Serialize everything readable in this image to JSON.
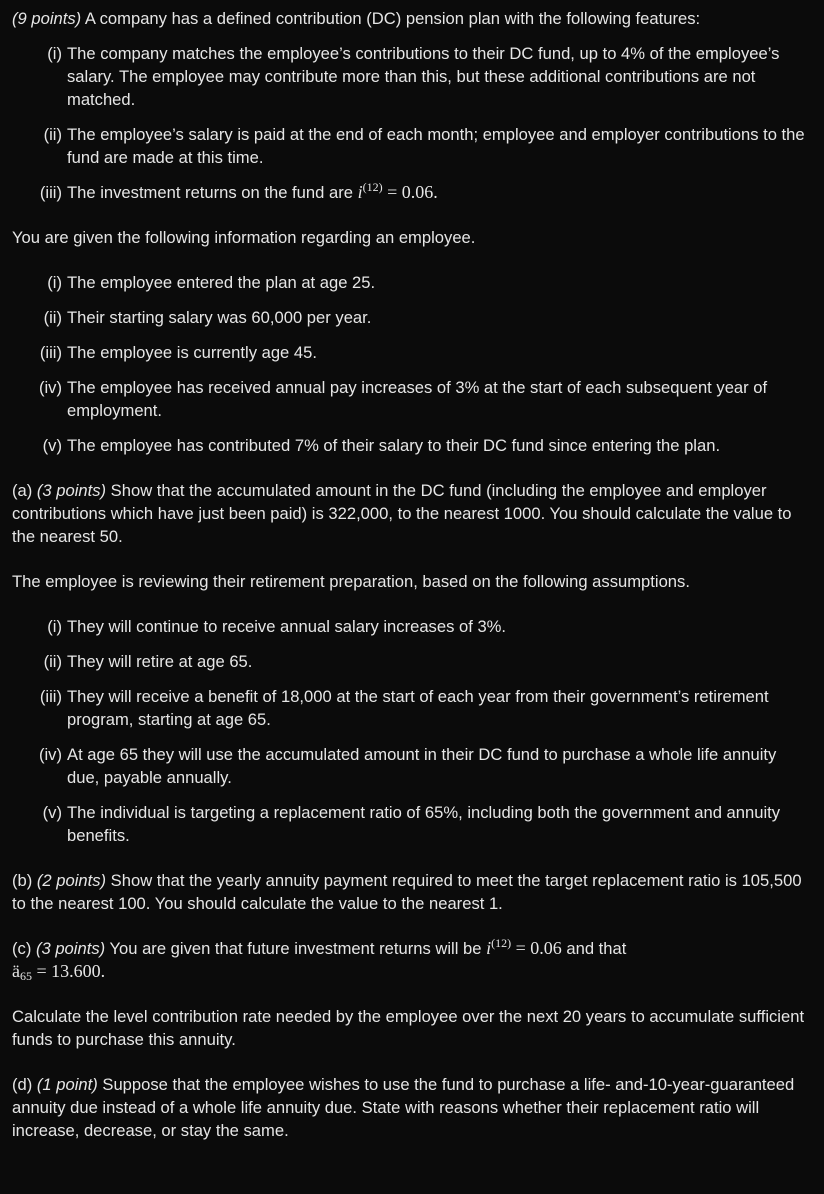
{
  "intro": {
    "points": "(9 points)",
    "text": " A company has a defined contribution (DC) pension plan with the following features:"
  },
  "features": [
    {
      "num": "(i)",
      "text": "The company matches the employee’s contributions to their DC fund, up to 4% of the employee’s salary. The employee may contribute more than this, but these additional contributions are not matched."
    },
    {
      "num": "(ii)",
      "text": "The employee’s salary is paid at the end of each month; employee and employer contributions to the fund are made at this time."
    },
    {
      "num": "(iii)",
      "text": "The investment returns on the fund are ",
      "math_var": "i",
      "math_sup": "(12)",
      "math_rest": " = 0.06."
    }
  ],
  "employee_intro": "You are given the following information regarding an employee.",
  "employee_info": [
    {
      "num": "(i)",
      "text": "The employee entered the plan at age 25."
    },
    {
      "num": "(ii)",
      "text": "Their starting salary was 60,000 per year."
    },
    {
      "num": "(iii)",
      "text": "The employee is currently age 45."
    },
    {
      "num": "(iv)",
      "text": "The employee has received annual pay increases of 3% at the start of each subsequent year of employment."
    },
    {
      "num": "(v)",
      "text": "The employee has contributed 7% of their salary to their DC fund since entering the plan."
    }
  ],
  "part_a": {
    "label": "(a) ",
    "points": "(3 points)",
    "text": " Show that the accumulated amount in the DC fund (including the employee and employer contributions which have just been paid) is 322,000, to the nearest 1000. You should calculate the value to the nearest 50."
  },
  "review_intro": "The employee is reviewing their retirement preparation, based on the following assumptions.",
  "assumptions": [
    {
      "num": "(i)",
      "text": "They will continue to receive annual salary increases of 3%."
    },
    {
      "num": "(ii)",
      "text": "They will retire at age 65."
    },
    {
      "num": "(iii)",
      "text": "They will receive a benefit of 18,000 at the start of each year from their government’s retirement program, starting at age 65."
    },
    {
      "num": "(iv)",
      "text": "At age 65 they will use the accumulated amount in their DC fund to purchase a whole life annuity due, payable annually."
    },
    {
      "num": "(v)",
      "text": "The individual is targeting a replacement ratio of 65%, including both the government and annuity benefits."
    }
  ],
  "part_b": {
    "label": "(b) ",
    "points": "(2 points)",
    "text": " Show that the yearly annuity payment required to meet the target replacement ratio is 105,500 to the nearest 100. You should calculate the value to the nearest 1."
  },
  "part_c": {
    "label": "(c) ",
    "points": "(3 points)",
    "text": " You are given that future investment returns will be ",
    "math_var": "i",
    "math_sup": "(12)",
    "math_rest": " = 0.06",
    "text2": " and that",
    "math2_base": "ä",
    "math2_sub": "65",
    "math2_rest": " = 13.600."
  },
  "part_c_question": "Calculate the level contribution rate needed by the employee over the next 20 years to accumulate sufficient funds to purchase this annuity.",
  "part_d": {
    "label": "(d) ",
    "points": "(1 point)",
    "text": " Suppose that the employee wishes to use the fund to purchase a life- and-10-year-guaranteed annuity due instead of a whole life annuity due. State with reasons whether their replacement ratio will increase, decrease, or stay the same."
  }
}
